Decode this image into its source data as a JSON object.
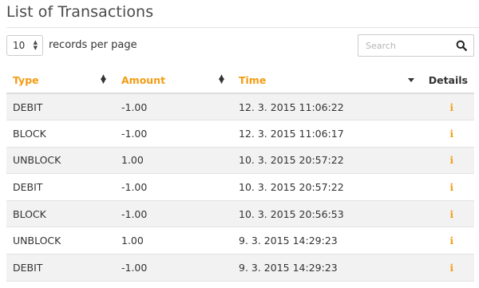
{
  "page": {
    "title": "List of Transactions"
  },
  "controls": {
    "page_length_value": "10",
    "page_length_label": "records per page",
    "search_placeholder": "Search"
  },
  "table": {
    "headers": {
      "type": "Type",
      "amount": "Amount",
      "time": "Time",
      "details": "Details"
    },
    "sorted_column": "time",
    "sort_direction": "descending",
    "rows": [
      {
        "type": "DEBIT",
        "amount": "-1.00",
        "time": "12. 3. 2015 11:06:22"
      },
      {
        "type": "BLOCK",
        "amount": "-1.00",
        "time": "12. 3. 2015 11:06:17"
      },
      {
        "type": "UNBLOCK",
        "amount": "1.00",
        "time": "10. 3. 2015 20:57:22"
      },
      {
        "type": "DEBIT",
        "amount": "-1.00",
        "time": "10. 3. 2015 20:57:22"
      },
      {
        "type": "BLOCK",
        "amount": "-1.00",
        "time": "10. 3. 2015 20:56:53"
      },
      {
        "type": "UNBLOCK",
        "amount": "1.00",
        "time": "9. 3. 2015 14:29:23"
      },
      {
        "type": "DEBIT",
        "amount": "-1.00",
        "time": "9. 3. 2015 14:29:23"
      }
    ],
    "details_icon": "info-icon"
  },
  "colors": {
    "accent": "#f39c12",
    "text": "#333333",
    "striped_row": "#f2f2f2",
    "border": "#dcdcdc"
  }
}
